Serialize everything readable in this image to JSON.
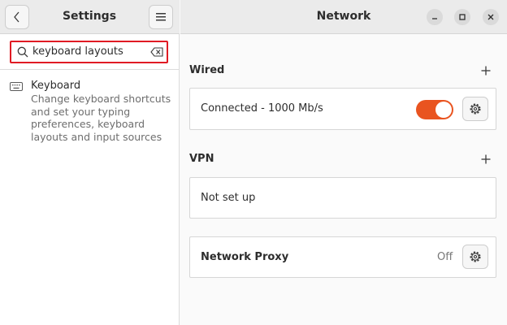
{
  "sidebar": {
    "title": "Settings",
    "search": {
      "value": "keyboard layouts"
    },
    "results": [
      {
        "title": "Keyboard",
        "description": "Change keyboard shortcuts and set your typing preferences, keyboard layouts and input sources",
        "icon": "keyboard-icon"
      }
    ]
  },
  "main": {
    "title": "Network",
    "wired": {
      "title": "Wired",
      "connection_label": "Connected - 1000 Mb/s",
      "toggle_on": true
    },
    "vpn": {
      "title": "VPN",
      "status": "Not set up"
    },
    "proxy": {
      "label": "Network Proxy",
      "status": "Off"
    }
  },
  "colors": {
    "accent": "#e95420",
    "search_highlight": "#e01b24"
  }
}
